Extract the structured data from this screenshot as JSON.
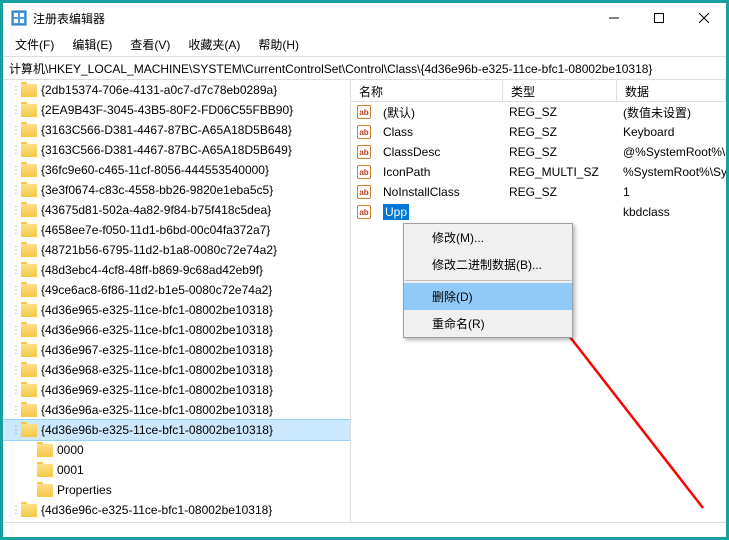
{
  "window": {
    "title": "注册表编辑器"
  },
  "menu": {
    "file": "文件(F)",
    "edit": "编辑(E)",
    "view": "查看(V)",
    "favorites": "收藏夹(A)",
    "help": "帮助(H)"
  },
  "address": "计算机\\HKEY_LOCAL_MACHINE\\SYSTEM\\CurrentControlSet\\Control\\Class\\{4d36e96b-e325-11ce-bfc1-08002be10318}",
  "tree": {
    "items": [
      "{2db15374-706e-4131-a0c7-d7c78eb0289a}",
      "{2EA9B43F-3045-43B5-80F2-FD06C55FBB90}",
      "{3163C566-D381-4467-87BC-A65A18D5B648}",
      "{3163C566-D381-4467-87BC-A65A18D5B649}",
      "{36fc9e60-c465-11cf-8056-444553540000}",
      "{3e3f0674-c83c-4558-bb26-9820e1eba5c5}",
      "{43675d81-502a-4a82-9f84-b75f418c5dea}",
      "{4658ee7e-f050-11d1-b6bd-00c04fa372a7}",
      "{48721b56-6795-11d2-b1a8-0080c72e74a2}",
      "{48d3ebc4-4cf8-48ff-b869-9c68ad42eb9f}",
      "{49ce6ac8-6f86-11d2-b1e5-0080c72e74a2}",
      "{4d36e965-e325-11ce-bfc1-08002be10318}",
      "{4d36e966-e325-11ce-bfc1-08002be10318}",
      "{4d36e967-e325-11ce-bfc1-08002be10318}",
      "{4d36e968-e325-11ce-bfc1-08002be10318}",
      "{4d36e969-e325-11ce-bfc1-08002be10318}",
      "{4d36e96a-e325-11ce-bfc1-08002be10318}"
    ],
    "selected": "{4d36e96b-e325-11ce-bfc1-08002be10318}",
    "children": [
      "0000",
      "0001",
      "Properties"
    ],
    "after": "{4d36e96c-e325-11ce-bfc1-08002be10318}"
  },
  "list": {
    "headers": {
      "name": "名称",
      "type": "类型",
      "data": "数据"
    },
    "rows": [
      {
        "name": "(默认)",
        "type": "REG_SZ",
        "data": "(数值未设置)"
      },
      {
        "name": "Class",
        "type": "REG_SZ",
        "data": "Keyboard"
      },
      {
        "name": "ClassDesc",
        "type": "REG_SZ",
        "data": "@%SystemRoot%\\S"
      },
      {
        "name": "IconPath",
        "type": "REG_MULTI_SZ",
        "data": "%SystemRoot%\\Sys"
      },
      {
        "name": "NoInstallClass",
        "type": "REG_SZ",
        "data": "1"
      }
    ],
    "selected": {
      "name": "Upp",
      "type": "",
      "data": "kbdclass"
    }
  },
  "context": {
    "modify": "修改(M)...",
    "modifyBinary": "修改二进制数据(B)...",
    "delete": "删除(D)",
    "rename": "重命名(R)"
  }
}
